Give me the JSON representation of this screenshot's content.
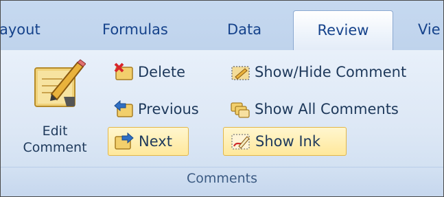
{
  "tabs": [
    {
      "label": "ayout"
    },
    {
      "label": "Formulas"
    },
    {
      "label": "Data"
    },
    {
      "label": "Review"
    },
    {
      "label": "Vie"
    }
  ],
  "active_tab": "Review",
  "comments_group": {
    "edit_comment": {
      "line1": "Edit",
      "line2": "Comment",
      "icon": "edit-comment-icon"
    },
    "delete": {
      "label": "Delete",
      "icon": "delete-comment-icon"
    },
    "previous": {
      "label": "Previous",
      "icon": "previous-comment-icon"
    },
    "next": {
      "label": "Next",
      "icon": "next-comment-icon"
    },
    "show_hide": {
      "label": "Show/Hide Comment",
      "icon": "show-hide-comment-icon"
    },
    "show_all": {
      "label": "Show All Comments",
      "icon": "show-all-comments-icon"
    },
    "show_ink": {
      "label": "Show Ink",
      "icon": "show-ink-icon"
    },
    "group_label": "Comments"
  },
  "colors": {
    "tab_text": "#15428b",
    "highlight_fill": "#ffe89b",
    "highlight_border": "#e2b648"
  }
}
